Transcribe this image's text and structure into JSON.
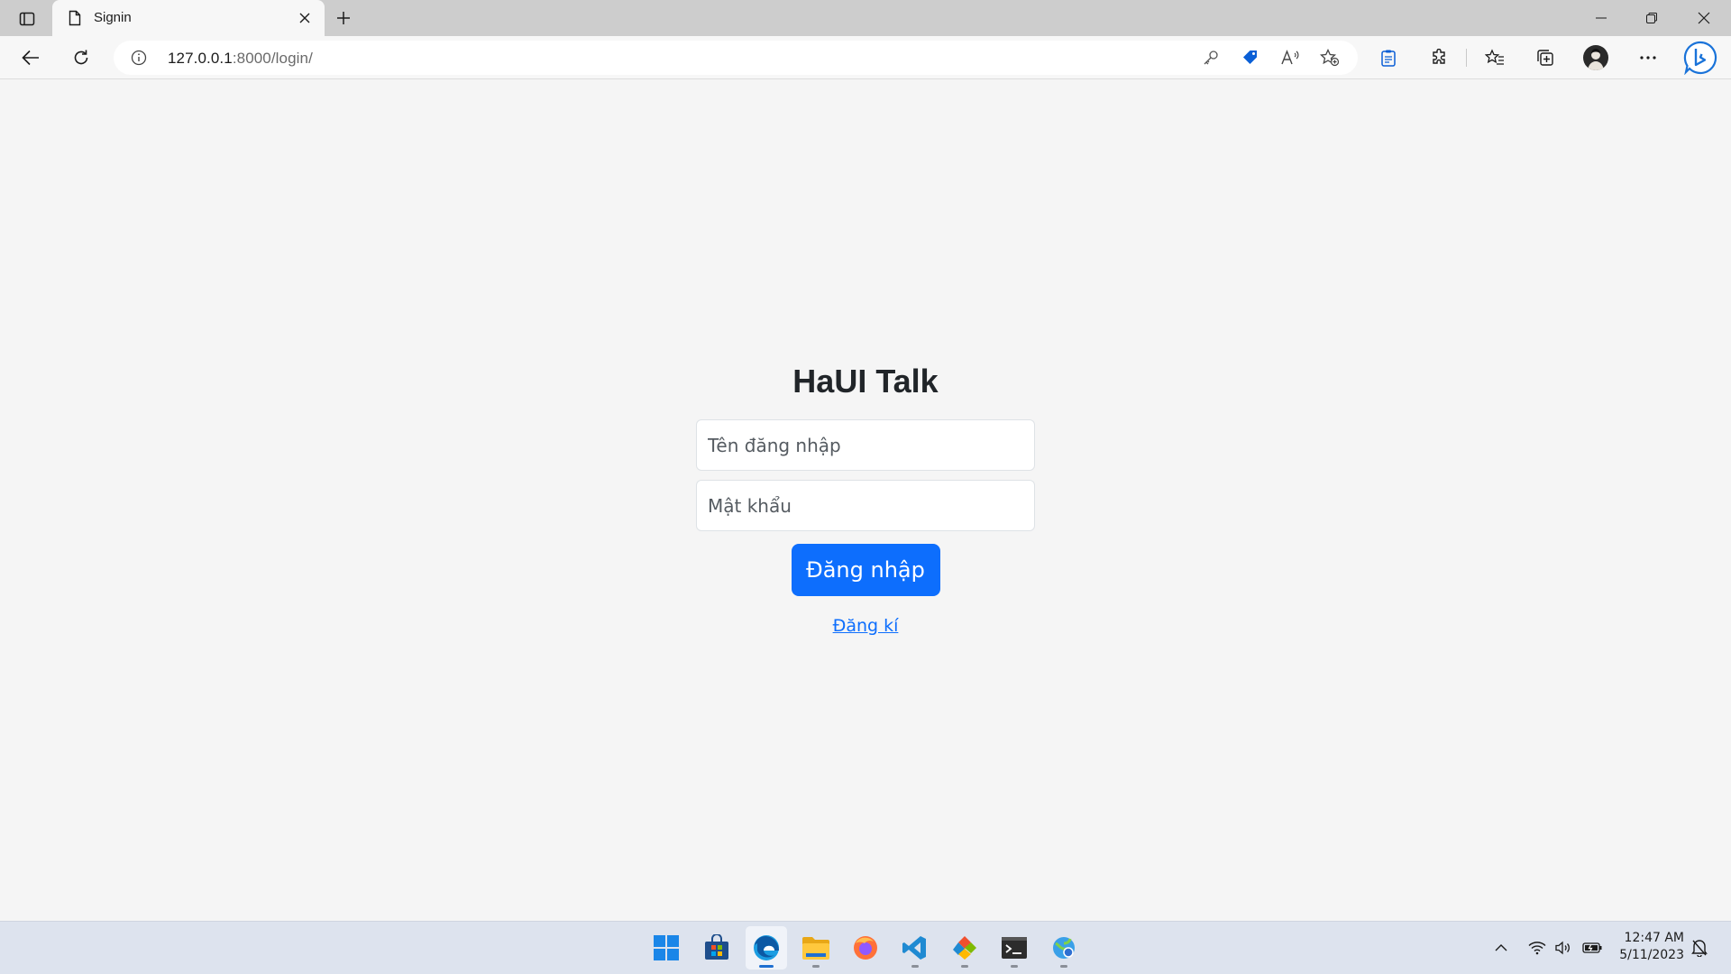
{
  "browser": {
    "tab": {
      "title": "Signin"
    },
    "url_host": "127.0.0.1",
    "url_rest": ":8000/login/"
  },
  "page": {
    "title": "HaUI Talk",
    "username_placeholder": "Tên đăng nhập",
    "password_placeholder": "Mật khẩu",
    "login_button": "Đăng nhập",
    "signup_link": "Đăng kí"
  },
  "taskbar": {
    "time": "12:47 AM",
    "date": "5/11/2023",
    "apps": [
      "start",
      "microsoft-store",
      "edge",
      "file-explorer",
      "firefox",
      "vs-code",
      "git",
      "terminal",
      "network-tool"
    ]
  },
  "colors": {
    "primary": "#0d6efd",
    "page_background": "#f5f5f5",
    "tabstrip": "#cdcdcd",
    "taskbar": "#dde3ee"
  }
}
